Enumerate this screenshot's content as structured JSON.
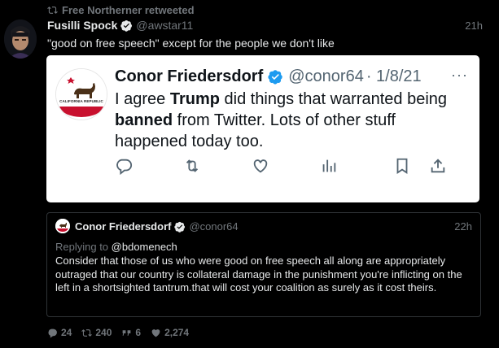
{
  "retweet": {
    "label": "Free Northerner retweeted"
  },
  "tweet": {
    "author_name": "Fusilli Spock",
    "handle": "@awstar11",
    "time": "21h",
    "text": "\"good on free speech\" except for the people we don't like"
  },
  "embedded": {
    "author_name": "Conor Friedersdorf",
    "handle": "@conor64",
    "date": "· 1/8/21",
    "body_1": "I agree ",
    "body_bold_1": "Trump",
    "body_2": " did things that warranted being ",
    "body_bold_2": "banned",
    "body_3": " from Twitter. Lots of other stuff happened today too.",
    "avatar_label": "CALIFORNIA REPUBLIC"
  },
  "quote": {
    "author_name": "Conor Friedersdorf",
    "handle": "@conor64",
    "time": "22h",
    "replying_prefix": "Replying to ",
    "replying_to": "@bdomenech",
    "text": "Consider that those of us who were good on free speech all along are appropriately outraged that our country is collateral damage in the punishment you're inflicting on the left in a shortsighted tantrum.that will cost your coalition as surely as it cost theirs."
  },
  "stats": {
    "replies": "24",
    "retweets": "240",
    "quotes": "6",
    "likes": "2,274"
  },
  "colors": {
    "background": "#000000",
    "verified": "#1d9bf0",
    "muted": "#71767b"
  }
}
